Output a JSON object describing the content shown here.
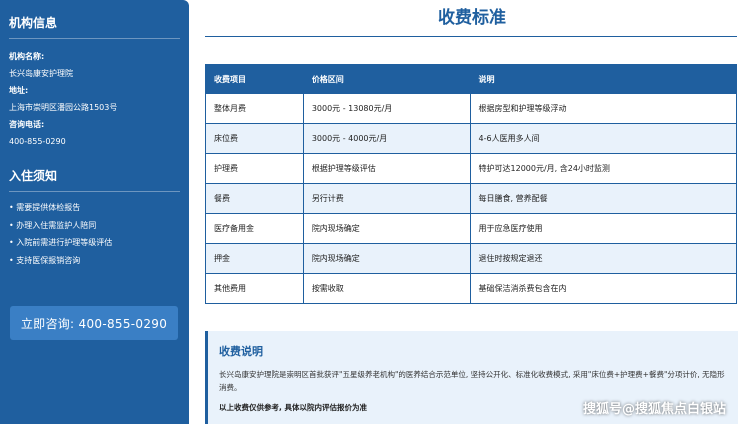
{
  "sidebar": {
    "org_heading": "机构信息",
    "name_label": "机构名称:",
    "name_value": "长兴岛康安护理院",
    "address_label": "地址:",
    "address_value": "上海市崇明区潘园公路1503号",
    "phone_label": "咨询电话:",
    "phone_value": "400-855-0290",
    "admission_heading": "入住须知",
    "admission_items": [
      "需要提供体检报告",
      "办理入住需监护人陪同",
      "入院前需进行护理等级评估",
      "支持医保报销咨询"
    ],
    "consult_button": "立即咨询: 400-855-0290"
  },
  "main": {
    "title": "收费标准",
    "table": {
      "headers": [
        "收费项目",
        "价格区间",
        "说明"
      ],
      "rows": [
        [
          "整体月费",
          "3000元 - 13080元/月",
          "根据房型和护理等级浮动"
        ],
        [
          "床位费",
          "3000元 - 4000元/月",
          "4-6人医用多人间"
        ],
        [
          "护理费",
          "根据护理等级评估",
          "特护可达12000元/月, 含24小时监测"
        ],
        [
          "餐费",
          "另行计费",
          "每日膳食, 营养配餐"
        ],
        [
          "医疗备用金",
          "院内现场确定",
          "用于应急医疗使用"
        ],
        [
          "押金",
          "院内现场确定",
          "退住时按规定退还"
        ],
        [
          "其他费用",
          "按需收取",
          "基础保洁消杀费包含在内"
        ]
      ]
    },
    "note": {
      "title": "收费说明",
      "text": "长兴岛康安护理院是崇明区首批获评\"五星级养老机构\"的医养结合示范单位, 坚持公开化、标准化收费模式, 采用\"床位费+护理费+餐费\"分项计价, 无隐形消费。",
      "bold": "以上收费仅供参考, 具体以院内评估报价为准"
    }
  },
  "watermark": "搜狐号@搜狐焦点白银站"
}
